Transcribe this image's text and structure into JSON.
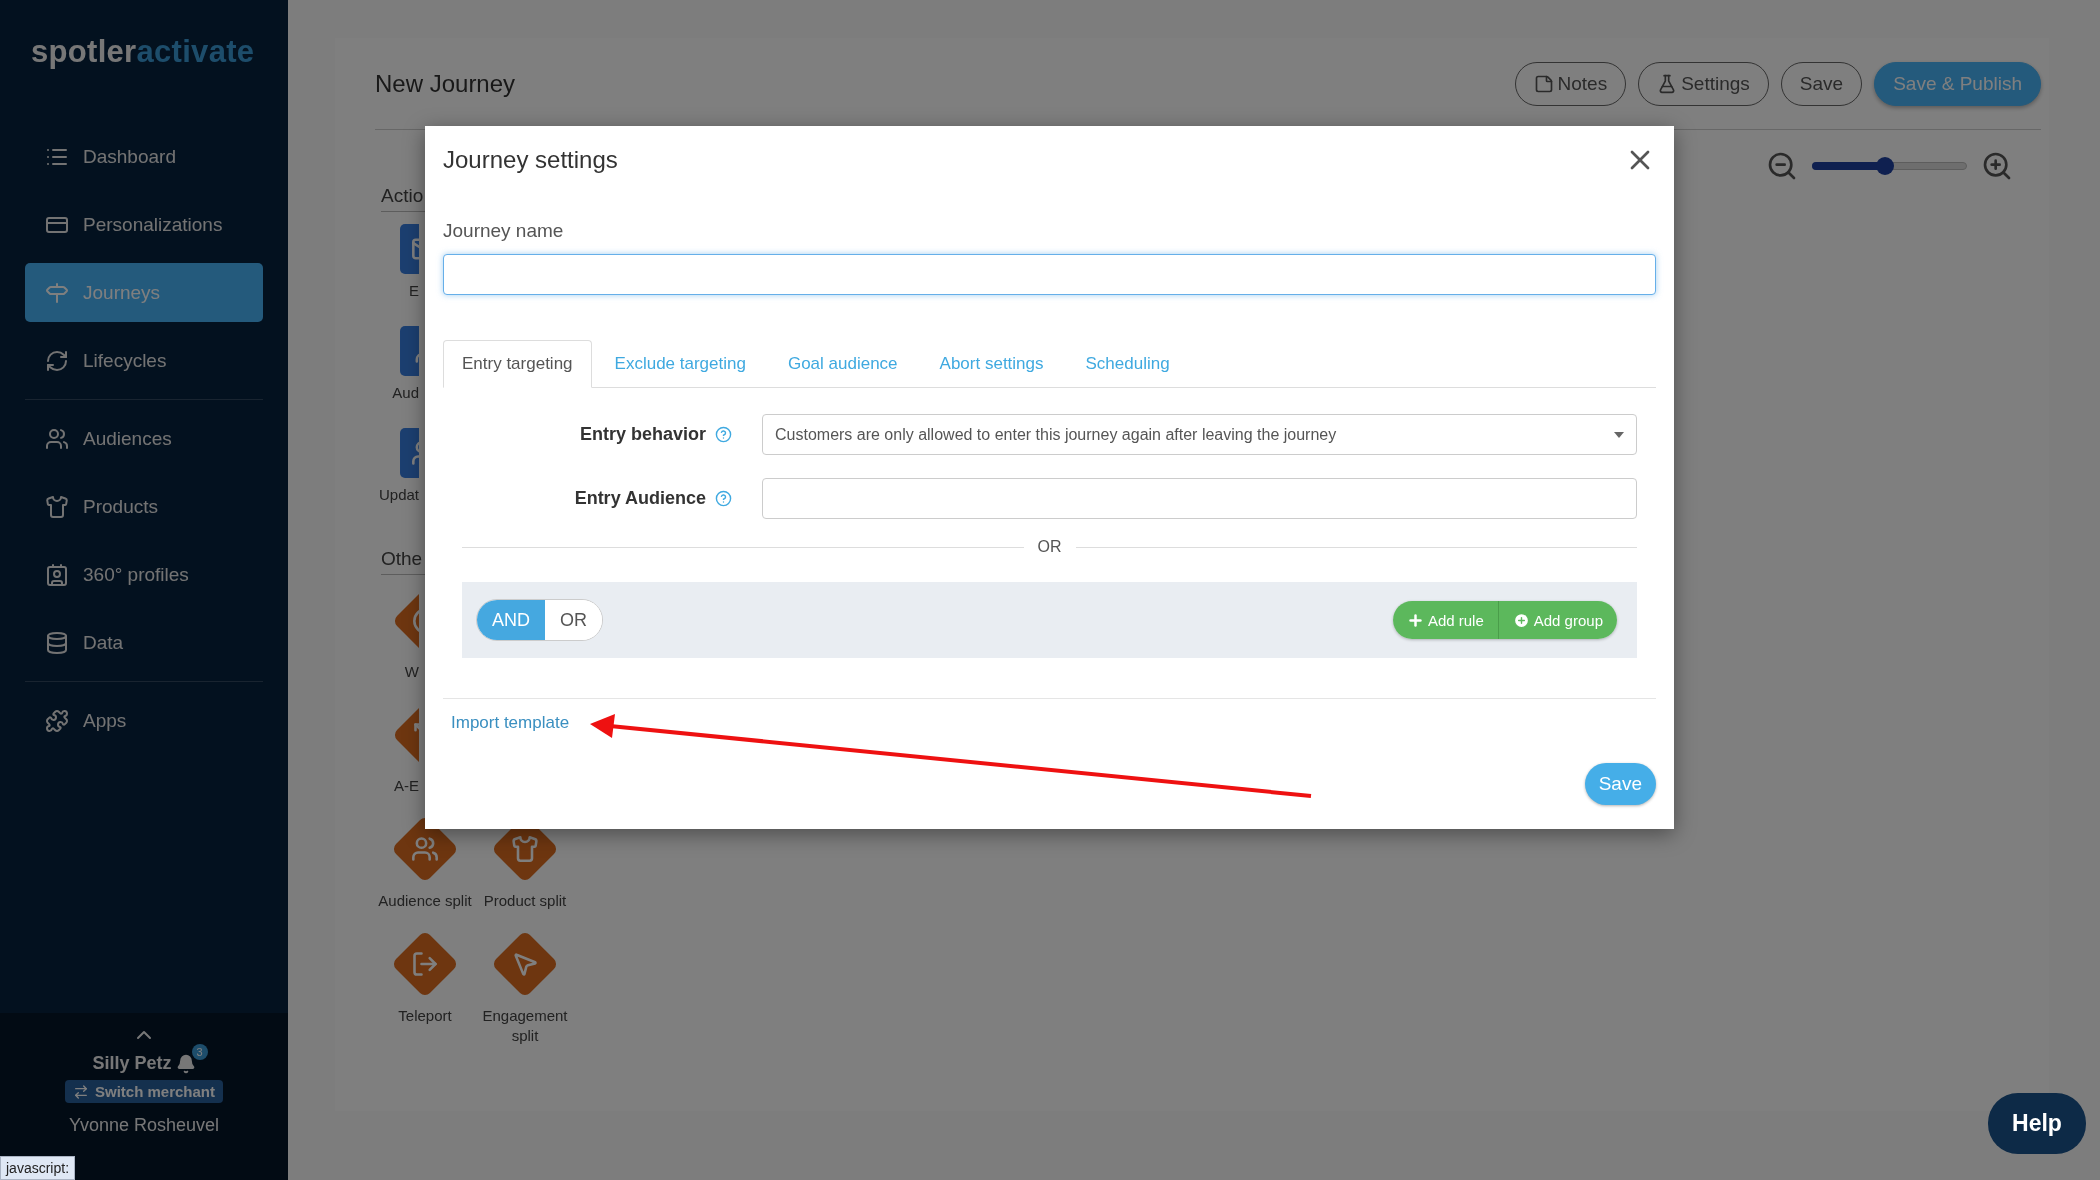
{
  "sidebar": {
    "logo": [
      "spotler",
      "activate"
    ],
    "groups": [
      [
        {
          "label": "Dashboard",
          "selected": false
        },
        {
          "label": "Personalizations",
          "selected": false
        },
        {
          "label": "Journeys",
          "selected": true
        },
        {
          "label": "Lifecycles",
          "selected": false
        }
      ],
      [
        {
          "label": "Audiences",
          "selected": false
        },
        {
          "label": "Products",
          "selected": false
        },
        {
          "label": "360° profiles",
          "selected": false
        },
        {
          "label": "Data",
          "selected": false
        }
      ],
      [
        {
          "label": "Apps",
          "selected": false
        }
      ]
    ],
    "footer": {
      "merchant": "Silly Petz",
      "notifications": "3",
      "switch_button": "Switch merchant",
      "user": "Yvonne Rosheuvel"
    }
  },
  "page": {
    "title": "New Journey",
    "buttons": [
      {
        "label": "Notes",
        "kind": "outline"
      },
      {
        "label": "Settings",
        "kind": "outline"
      },
      {
        "label": "Save",
        "kind": "outline"
      },
      {
        "label": "Save & Publish",
        "kind": "primary"
      }
    ],
    "zoom": {
      "level": 0.47
    }
  },
  "palette": [
    {
      "title": "Actio",
      "items": [
        {
          "label": "E",
          "covered": true
        },
        {
          "label": "Aud",
          "covered": true
        },
        {
          "label": "Updat",
          "covered": true
        }
      ]
    },
    {
      "title": "Othe",
      "items": [
        {
          "label": "W",
          "covered": true
        },
        {
          "label": "A-E",
          "covered": true
        },
        {
          "label": "Audience split",
          "covered": false
        },
        {
          "label": "Product split",
          "covered": false
        },
        {
          "label": "Teleport",
          "covered": false
        },
        {
          "label": "Engagement split",
          "covered": false
        }
      ]
    }
  ],
  "dialog": {
    "title": "Journey settings",
    "name_label": "Journey name",
    "tabs": [
      {
        "label": "Entry targeting",
        "selected": true
      },
      {
        "label": "Exclude targeting",
        "selected": false
      },
      {
        "label": "Goal audience",
        "selected": false
      },
      {
        "label": "Abort settings",
        "selected": false
      },
      {
        "label": "Scheduling",
        "selected": false
      }
    ],
    "fields": [
      {
        "label": "Entry behavior",
        "kind": "select",
        "value": "Customers are only allowed to enter this journey again after leaving the journey"
      },
      {
        "label": "Entry Audience",
        "kind": "input"
      }
    ],
    "divider_text": "OR",
    "rule_group": {
      "operators": [
        {
          "label": "AND",
          "selected": true
        },
        {
          "label": "OR",
          "selected": false
        }
      ],
      "actions": [
        "Add rule",
        "Add group"
      ]
    },
    "import_link": "Import template",
    "save_button": "Save"
  },
  "help_button": "Help",
  "status_text": "javascript:"
}
